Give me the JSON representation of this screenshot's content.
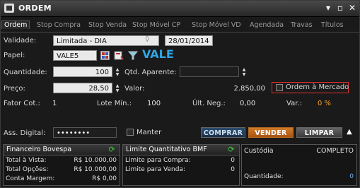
{
  "window": {
    "title": "ORDEM",
    "minimize_glyph": "▾",
    "restore_glyph": "▫",
    "close_glyph": "✕"
  },
  "tabs": [
    {
      "label": "Ordem"
    },
    {
      "label": "Stop Compra"
    },
    {
      "label": "Stop Venda"
    },
    {
      "label": "Stop Móvel CP"
    },
    {
      "label": "Stop Móvel VD"
    },
    {
      "label": "Agendada"
    },
    {
      "label": "Travas"
    },
    {
      "label": "Títulos"
    }
  ],
  "form": {
    "validade_label": "Validade:",
    "validade_value": "Limitada - DIA",
    "validade_date": "28/01/2014",
    "papel_label": "Papel:",
    "papel_value": "VALE5",
    "papel_display": "VALE",
    "quantidade_label": "Quantidade:",
    "quantidade_value": "100",
    "qtd_aparente_label": "Qtd. Aparente:",
    "qtd_aparente_value": "",
    "preco_label": "Preço:",
    "preco_value": "28,50",
    "valor_label": "Valor:",
    "valor_value": "2.850,00",
    "ordem_mercado_label": "Ordem à Mercado",
    "fator_cot_label": "Fator Cot.:",
    "fator_cot_value": "1",
    "lote_min_label": "Lote Mín.:",
    "lote_min_value": "100",
    "ult_neg_label": "Últ. Neg.:",
    "ult_neg_value": "0,00",
    "var_label": "Var.:",
    "var_value": "0 %",
    "ass_digital_label": "Ass. Digital:",
    "ass_digital_value": "••••••••",
    "manter_label": "Manter"
  },
  "buttons": {
    "comprar": "COMPRAR",
    "vender": "VENDER",
    "limpar": "LIMPAR",
    "collapse": "▲"
  },
  "financeiro": {
    "title": "Financeiro Bovespa",
    "rows": [
      {
        "label": "Total à Vista:",
        "value": "R$ 10.000,00"
      },
      {
        "label": "Total Opções:",
        "value": "R$ 10.000,00"
      },
      {
        "label": "Conta Margem:",
        "value": "R$ 0,00"
      }
    ]
  },
  "limite": {
    "title": "Limite Quantitativo BMF",
    "rows": [
      {
        "label": "Limite para Compra:",
        "value": "0"
      },
      {
        "label": "Limite para Venda:",
        "value": "0"
      }
    ]
  },
  "custodia": {
    "title": "Custódia",
    "status": "COMPLETO",
    "quantidade_label": "Quantidade:",
    "quantidade_value": "0"
  },
  "icons": {
    "app": "window-app-icon",
    "grid": "grid-icon",
    "book": "book-icon",
    "filter": "filter-icon",
    "refresh": "refresh-icon"
  },
  "colors": {
    "accent_orange": "#d07b2a",
    "accent_blue": "#2fa6e8",
    "highlight_red": "#e03030",
    "refresh_green": "#3cc93c"
  }
}
